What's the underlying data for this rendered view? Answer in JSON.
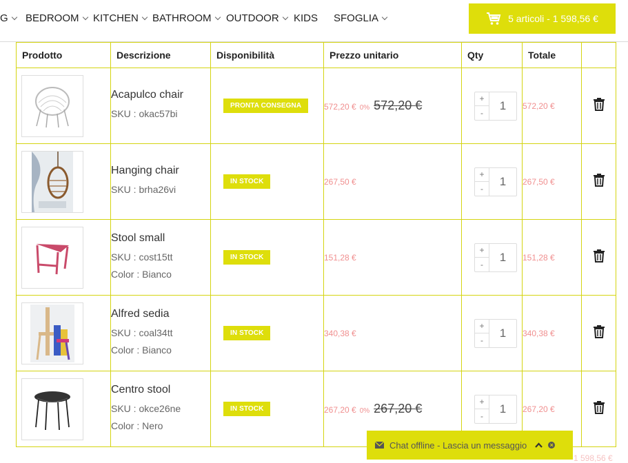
{
  "nav": {
    "items": [
      {
        "label": "G",
        "dropdown": true
      },
      {
        "label": "BEDROOM",
        "dropdown": true
      },
      {
        "label": "KITCHEN",
        "dropdown": true
      },
      {
        "label": "BATHROOM",
        "dropdown": true
      },
      {
        "label": "OUTDOOR",
        "dropdown": true
      },
      {
        "label": "KIDS",
        "dropdown": false
      },
      {
        "label": "SFOGLIA",
        "dropdown": true
      }
    ],
    "cart": {
      "label": "5 articoli - 1 598,56 €",
      "icon": "cart-icon"
    }
  },
  "table": {
    "headers": [
      "Prodotto",
      "Descrizione",
      "Disponibilità",
      "Prezzo unitario",
      "Qty",
      "Totale",
      ""
    ],
    "rows": [
      {
        "name": "Acapulco chair",
        "sku": "SKU : okac57bi",
        "color": "",
        "availability": "PRONTA CONSEGNA",
        "price": "572,20 €",
        "discount": "0%",
        "old_price": "572,20 €",
        "qty": "1",
        "total": "572,20 €"
      },
      {
        "name": "Hanging chair",
        "sku": "SKU : brha26vi",
        "color": "",
        "availability": "IN STOCK",
        "price": "267,50 €",
        "discount": "",
        "old_price": "",
        "qty": "1",
        "total": "267,50 €"
      },
      {
        "name": "Stool small",
        "sku": "SKU : cost15tt",
        "color": "Color : Bianco",
        "availability": "IN STOCK",
        "price": "151,28 €",
        "discount": "",
        "old_price": "",
        "qty": "1",
        "total": "151,28 €"
      },
      {
        "name": "Alfred sedia",
        "sku": "SKU : coal34tt",
        "color": "Color : Bianco",
        "availability": "IN STOCK",
        "price": "340,38 €",
        "discount": "",
        "old_price": "",
        "qty": "1",
        "total": "340,38 €"
      },
      {
        "name": "Centro stool",
        "sku": "SKU : okce26ne",
        "color": "Color : Nero",
        "availability": "IN STOCK",
        "price": "267,20 €",
        "discount": "0%",
        "old_price": "267,20 €",
        "qty": "1",
        "total": "267,20 €"
      }
    ],
    "qty_plus": "+",
    "qty_minus": "-"
  },
  "chat": {
    "label": "Chat offline - Lascia un messaggio"
  },
  "footer_total": "1 598,56 €",
  "colors": {
    "accent": "#dede0b",
    "price": "#f08f8f",
    "border": "#d4d40f"
  }
}
